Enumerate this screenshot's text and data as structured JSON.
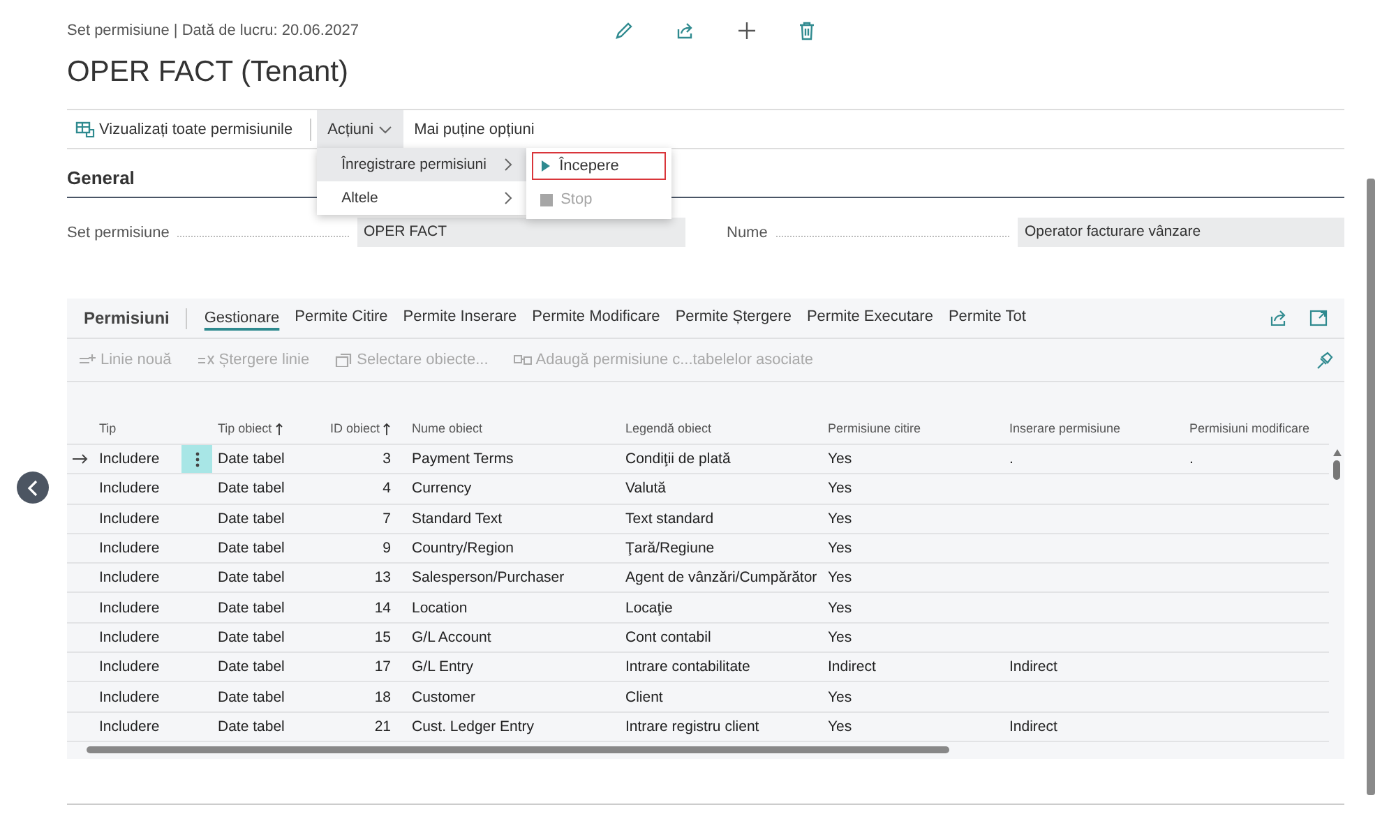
{
  "header": {
    "caption": "Set permisiune | Dată de lucru: 20.06.2027",
    "title": "OPER FACT (Tenant)"
  },
  "action_bar": {
    "items": [
      {
        "kind": "button",
        "label": "Vizualizați toate permisiunile"
      },
      {
        "kind": "menu",
        "label": "Acțiuni",
        "expanded": true
      },
      {
        "kind": "link",
        "label": "Mai puține opțiuni"
      }
    ]
  },
  "actions_menu": {
    "items": [
      {
        "label": "Înregistrare permisiuni",
        "selected": true
      },
      {
        "label": "Altele",
        "selected": false
      }
    ],
    "submenu": {
      "items": [
        {
          "kind": "start",
          "label": "Începere",
          "highlighted": true,
          "disabled": false
        },
        {
          "kind": "stop",
          "label": "Stop",
          "highlighted": false,
          "disabled": true
        }
      ]
    }
  },
  "general": {
    "heading": "General",
    "fields": [
      {
        "label": "Set permisiune",
        "value": "OPER FACT"
      },
      {
        "label": "Nume",
        "value": "Operator facturare vânzare"
      }
    ]
  },
  "permissions": {
    "title": "Permisiuni",
    "tabs": [
      {
        "label": "Gestionare",
        "selected": true
      },
      {
        "label": "Permite Citire",
        "selected": false
      },
      {
        "label": "Permite Inserare",
        "selected": false
      },
      {
        "label": "Permite Modificare",
        "selected": false
      },
      {
        "label": "Permite Ștergere",
        "selected": false
      },
      {
        "label": "Permite Executare",
        "selected": false
      },
      {
        "label": "Permite Tot",
        "selected": false
      }
    ],
    "actions": [
      {
        "kind": "new",
        "label": "Linie nouă",
        "disabled": true
      },
      {
        "kind": "delete",
        "label": "Ștergere linie",
        "disabled": true
      },
      {
        "kind": "select",
        "label": "Selectare obiecte...",
        "disabled": true
      },
      {
        "kind": "add",
        "label": "Adaugă permisiune c...tabelelor asociate",
        "disabled": true
      }
    ],
    "table": {
      "columns": [
        {
          "label": "Tip",
          "sorted": false
        },
        {
          "label": "Tip obiect",
          "sorted": true
        },
        {
          "label": "ID obiect",
          "sorted": true
        },
        {
          "label": "Nume obiect",
          "sorted": false
        },
        {
          "label": "Legendă obiect",
          "sorted": false
        },
        {
          "label": "Permisiune citire",
          "sorted": false
        },
        {
          "label": "Inserare permisiune",
          "sorted": false
        },
        {
          "label": "Permisiuni modificare",
          "sorted": false
        }
      ],
      "rows": [
        {
          "current": true,
          "cells": [
            "Includere",
            "Date tabel",
            "3",
            "Payment Terms",
            "Condiţii de plată",
            "Yes",
            ".",
            "."
          ]
        },
        {
          "current": false,
          "cells": [
            "Includere",
            "Date tabel",
            "4",
            "Currency",
            "Valută",
            "Yes"
          ]
        },
        {
          "current": false,
          "cells": [
            "Includere",
            "Date tabel",
            "7",
            "Standard Text",
            "Text standard",
            "Yes"
          ]
        },
        {
          "current": false,
          "cells": [
            "Includere",
            "Date tabel",
            "9",
            "Country/Region",
            "Ţară/Regiune",
            "Yes"
          ]
        },
        {
          "current": false,
          "cells": [
            "Includere",
            "Date tabel",
            "13",
            "Salesperson/Purchaser",
            "Agent de vânzări/Cumpărător",
            "Yes"
          ]
        },
        {
          "current": false,
          "cells": [
            "Includere",
            "Date tabel",
            "14",
            "Location",
            "Locaţie",
            "Yes"
          ]
        },
        {
          "current": false,
          "cells": [
            "Includere",
            "Date tabel",
            "15",
            "G/L Account",
            "Cont contabil",
            "Yes"
          ]
        },
        {
          "current": false,
          "cells": [
            "Includere",
            "Date tabel",
            "17",
            "G/L Entry",
            "Intrare contabilitate",
            "Indirect",
            "Indirect"
          ]
        },
        {
          "current": false,
          "cells": [
            "Includere",
            "Date tabel",
            "18",
            "Customer",
            "Client",
            "Yes"
          ]
        },
        {
          "current": false,
          "cells": [
            "Includere",
            "Date tabel",
            "21",
            "Cust. Ledger Entry",
            "Intrare registru client",
            "Yes",
            "Indirect"
          ]
        }
      ]
    }
  }
}
